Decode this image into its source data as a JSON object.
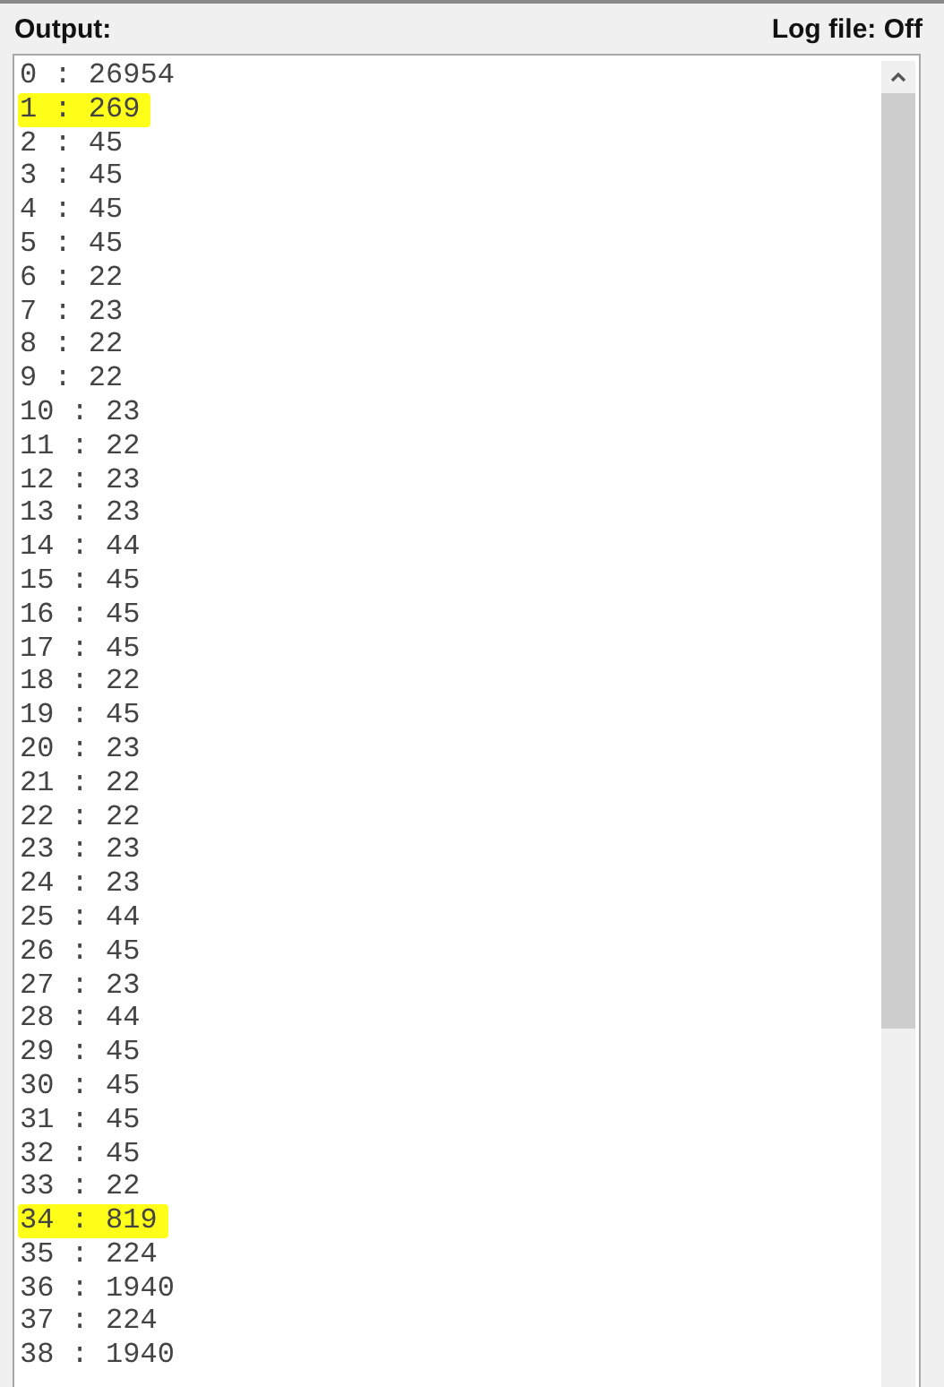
{
  "header": {
    "title": "Output:",
    "log_status": "Log file: Off"
  },
  "output_lines": [
    {
      "text": "0 : 26954",
      "highlighted": false
    },
    {
      "text": "1 : 269",
      "highlighted": true
    },
    {
      "text": "2 : 45",
      "highlighted": false
    },
    {
      "text": "3 : 45",
      "highlighted": false
    },
    {
      "text": "4 : 45",
      "highlighted": false
    },
    {
      "text": "5 : 45",
      "highlighted": false
    },
    {
      "text": "6 : 22",
      "highlighted": false
    },
    {
      "text": "7 : 23",
      "highlighted": false
    },
    {
      "text": "8 : 22",
      "highlighted": false
    },
    {
      "text": "9 : 22",
      "highlighted": false
    },
    {
      "text": "10 : 23",
      "highlighted": false
    },
    {
      "text": "11 : 22",
      "highlighted": false
    },
    {
      "text": "12 : 23",
      "highlighted": false
    },
    {
      "text": "13 : 23",
      "highlighted": false
    },
    {
      "text": "14 : 44",
      "highlighted": false
    },
    {
      "text": "15 : 45",
      "highlighted": false
    },
    {
      "text": "16 : 45",
      "highlighted": false
    },
    {
      "text": "17 : 45",
      "highlighted": false
    },
    {
      "text": "18 : 22",
      "highlighted": false
    },
    {
      "text": "19 : 45",
      "highlighted": false
    },
    {
      "text": "20 : 23",
      "highlighted": false
    },
    {
      "text": "21 : 22",
      "highlighted": false
    },
    {
      "text": "22 : 22",
      "highlighted": false
    },
    {
      "text": "23 : 23",
      "highlighted": false
    },
    {
      "text": "24 : 23",
      "highlighted": false
    },
    {
      "text": "25 : 44",
      "highlighted": false
    },
    {
      "text": "26 : 45",
      "highlighted": false
    },
    {
      "text": "27 : 23",
      "highlighted": false
    },
    {
      "text": "28 : 44",
      "highlighted": false
    },
    {
      "text": "29 : 45",
      "highlighted": false
    },
    {
      "text": "30 : 45",
      "highlighted": false
    },
    {
      "text": "31 : 45",
      "highlighted": false
    },
    {
      "text": "32 : 45",
      "highlighted": false
    },
    {
      "text": "33 : 22",
      "highlighted": false
    },
    {
      "text": "34 : 819",
      "highlighted": true
    },
    {
      "text": "35 : 224",
      "highlighted": false
    },
    {
      "text": "36 : 1940",
      "highlighted": false
    },
    {
      "text": "37 : 224",
      "highlighted": false
    },
    {
      "text": "38 : 1940",
      "highlighted": false
    }
  ]
}
